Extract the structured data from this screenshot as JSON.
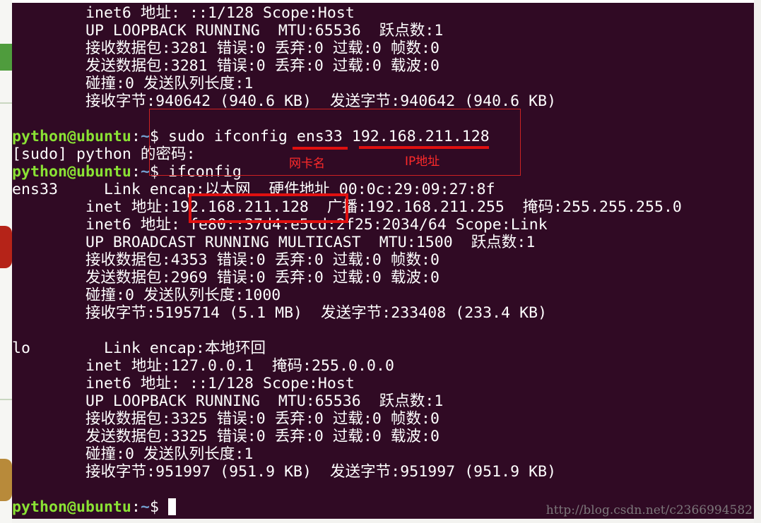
{
  "terminal": {
    "colors": {
      "background": "#300a24",
      "text": "#ffffff",
      "prompt_user": "#8ae234",
      "prompt_path": "#729fcf",
      "annotation": "#e01010"
    },
    "prompt": {
      "user_host": "python@ubuntu",
      "colon": ":",
      "path": "~",
      "symbol": "$ "
    },
    "lines": {
      "l1": "        inet6 地址: ::1/128 Scope:Host",
      "l2": "        UP LOOPBACK RUNNING  MTU:65536  跃点数:1",
      "l3": "        接收数据包:3281 错误:0 丢弃:0 过载:0 帧数:0",
      "l4": "        发送数据包:3281 错误:0 丢弃:0 过载:0 载波:0",
      "l5": "        碰撞:0 发送队列长度:1",
      "l6": "        接收字节:940642 (940.6 KB)  发送字节:940642 (940.6 KB)",
      "cmd1": "sudo ifconfig ens33 192.168.211.128",
      "l8": "[sudo] python 的密码:",
      "cmd2": "ifconfig",
      "l10": "ens33     Link encap:以太网  硬件地址 00:0c:29:09:27:8f",
      "l11": "        inet 地址:192.168.211.128  广播:192.168.211.255  掩码:255.255.255.0",
      "l12": "        inet6 地址: fe80::37d4:e5cd:2f25:2034/64 Scope:Link",
      "l13": "        UP BROADCAST RUNNING MULTICAST  MTU:1500  跃点数:1",
      "l14": "        接收数据包:4353 错误:0 丢弃:0 过载:0 帧数:0",
      "l15": "        发送数据包:2969 错误:0 丢弃:0 过载:0 载波:0",
      "l16": "        碰撞:0 发送队列长度:1000",
      "l17": "        接收字节:5195714 (5.1 MB)  发送字节:233408 (233.4 KB)",
      "l19": "lo        Link encap:本地环回",
      "l20": "        inet 地址:127.0.0.1  掩码:255.0.0.0",
      "l21": "        inet6 地址: ::1/128 Scope:Host",
      "l22": "        UP LOOPBACK RUNNING  MTU:65536  跃点数:1",
      "l23": "        接收数据包:3325 错误:0 丢弃:0 过载:0 帧数:0",
      "l24": "        发送数据包:3325 错误:0 丢弃:0 过载:0 载波:0",
      "l25": "        碰撞:0 发送队列长度:1",
      "l26": "        接收字节:951997 (951.9 KB)  发送字节:951997 (951.9 KB)"
    }
  },
  "annotations": {
    "nic_name_label": "网卡名",
    "ip_address_label": "IP地址"
  },
  "watermark": "http://blog.csdn.net/c2366994582"
}
